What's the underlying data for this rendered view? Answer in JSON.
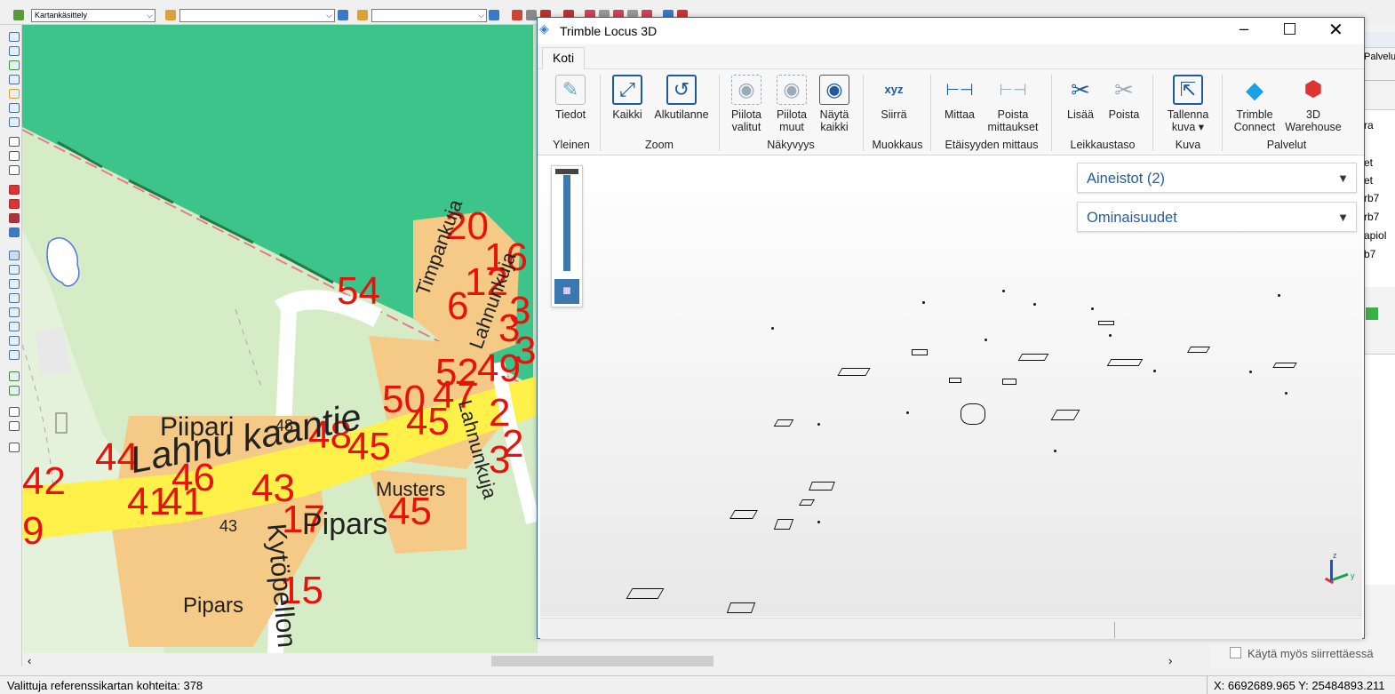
{
  "toolbar": {
    "mode_combo": "Kartankäsittely",
    "combo2": "",
    "combo3": ""
  },
  "map": {
    "labels_numbers": [
      "20",
      "16",
      "12",
      "6",
      "54",
      "3",
      "3",
      "3",
      "52",
      "49",
      "50",
      "47",
      "2",
      "45",
      "2",
      "3",
      "48",
      "45",
      "44",
      "46",
      "42",
      "46",
      "43",
      "41",
      "41",
      "17",
      "9",
      "45",
      "15",
      "43",
      "48",
      "20",
      "5",
      "1",
      "3"
    ],
    "place_names": [
      "Piipari",
      "Pipars",
      "Musters",
      "Pipars"
    ],
    "road_names": [
      "Lahnu kaantie",
      "Kytöpellon",
      "Timpankuja",
      "Lahnunkuja",
      "Lahnunkuja"
    ]
  },
  "window": {
    "title": "Trimble Locus 3D",
    "tab_home": "Koti",
    "buttons": {
      "tiedot": "Tiedot",
      "kaikki": "Kaikki",
      "alkutilanne": "Alkutilanne",
      "piilota_valitut_1": "Piilota",
      "piilota_valitut_2": "valitut",
      "piilota_muut_1": "Piilota",
      "piilota_muut_2": "muut",
      "nayta_kaikki_1": "Näytä",
      "nayta_kaikki_2": "kaikki",
      "siirra": "Siirrä",
      "mittaa": "Mittaa",
      "poista_mittaukset_1": "Poista",
      "poista_mittaukset_2": "mittaukset",
      "lisaa": "Lisää",
      "poista": "Poista",
      "tallenna_kuva_1": "Tallenna",
      "tallenna_kuva_2": "kuva ▾",
      "trimble_connect_1": "Trimble",
      "trimble_connect_2": "Connect",
      "warehouse_1": "3D",
      "warehouse_2": "Warehouse"
    },
    "groups": {
      "yleinen": "Yleinen",
      "zoom": "Zoom",
      "nakyvyys": "Näkyvyys",
      "muokkaus": "Muokkaus",
      "etaisyys": "Etäisyyden mittaus",
      "leikkaus": "Leikkaustaso",
      "kuva": "Kuva",
      "palvelut": "Palvelut"
    },
    "panels": {
      "aineistot": "Aineistot (2)",
      "ominaisuudet": "Ominaisuudet"
    },
    "axis": {
      "z": "z",
      "y": "y"
    }
  },
  "right_panel": {
    "partial_texts": [
      "Palvelu",
      "ra",
      "et",
      "et",
      "rb7",
      "rb7",
      "apiol",
      "b7"
    ],
    "checkbox_label": "Käytä myös siirrettäessä"
  },
  "status": {
    "left": "Valittuja referenssikartan kohteita: 378",
    "coords": "X: 6692689.965  Y: 25484893.211"
  }
}
